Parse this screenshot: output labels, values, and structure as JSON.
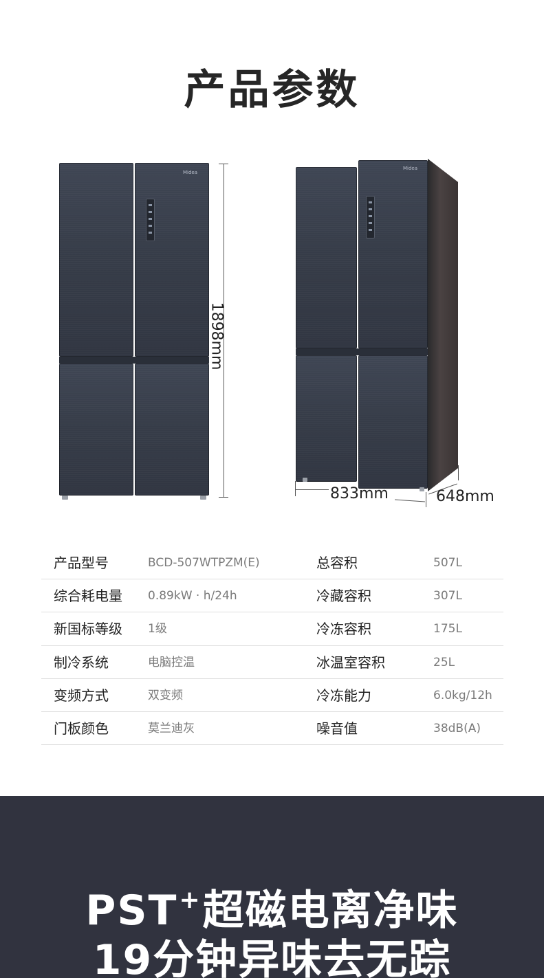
{
  "title": "产品参数",
  "brand_logo": "Midea",
  "dimensions": {
    "height": "1898mm",
    "width": "833mm",
    "depth": "648mm"
  },
  "specs": [
    {
      "label_left": "产品型号",
      "value_left": "BCD-507WTPZM(E)",
      "label_right": "总容积",
      "value_right": "507L"
    },
    {
      "label_left": "综合耗电量",
      "value_left": "0.89kW · h/24h",
      "label_right": "冷藏容积",
      "value_right": "307L"
    },
    {
      "label_left": "新国标等级",
      "value_left": "1级",
      "label_right": "冷冻容积",
      "value_right": "175L"
    },
    {
      "label_left": "制冷系统",
      "value_left": "电脑控温",
      "label_right": "冰温室容积",
      "value_right": "25L"
    },
    {
      "label_left": "变频方式",
      "value_left": "双变频",
      "label_right": "冷冻能力",
      "value_right": "6.0kg/12h"
    },
    {
      "label_left": "门板颜色",
      "value_left": "莫兰迪灰",
      "label_right": "噪音值",
      "value_right": "38dB(A)"
    }
  ],
  "banner": {
    "line1_prefix": "PST",
    "line1_sup": "+",
    "line1_suffix": "超磁电离净味",
    "line2": "19分钟异味去无踪"
  },
  "colors": {
    "banner_bg": "#31333f",
    "fridge_body": "#3a404c"
  }
}
